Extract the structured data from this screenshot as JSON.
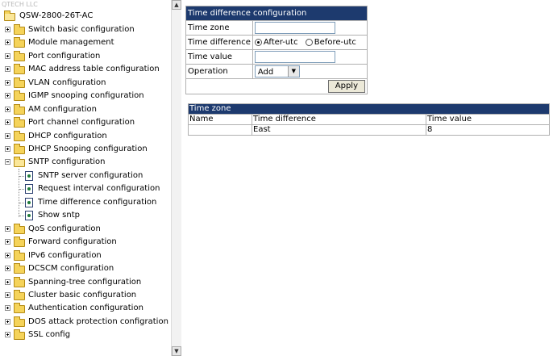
{
  "brand": "QTECH LLC",
  "tree": {
    "root": "QSW-2800-26T-AC",
    "items": [
      {
        "label": "Switch basic configuration"
      },
      {
        "label": "Module management"
      },
      {
        "label": "Port configuration"
      },
      {
        "label": "MAC address table configuration"
      },
      {
        "label": "VLAN configuration"
      },
      {
        "label": "IGMP snooping configuration"
      },
      {
        "label": "AM configuration"
      },
      {
        "label": "Port channel configuration"
      },
      {
        "label": "DHCP configuration"
      },
      {
        "label": "DHCP Snooping configuration"
      },
      {
        "label": "SNTP configuration"
      },
      {
        "label": "QoS configuration"
      },
      {
        "label": "Forward configuration"
      },
      {
        "label": "IPv6 configuration"
      },
      {
        "label": "DCSCM configuration"
      },
      {
        "label": "Spanning-tree configuration"
      },
      {
        "label": "Cluster basic configuration"
      },
      {
        "label": "Authentication configuration"
      },
      {
        "label": "DOS attack protection configration"
      },
      {
        "label": "SSL config"
      }
    ],
    "sntp_children": [
      {
        "label": "SNTP server configuration"
      },
      {
        "label": "Request interval configuration"
      },
      {
        "label": "Time difference configuration"
      },
      {
        "label": "Show sntp"
      }
    ]
  },
  "form": {
    "title": "Time difference configuration",
    "time_zone_label": "Time zone",
    "time_zone_value": "",
    "time_difference_label": "Time difference",
    "after_utc": "After-utc",
    "before_utc": "Before-utc",
    "time_value_label": "Time value",
    "time_value_value": "",
    "operation_label": "Operation",
    "operation_value": "Add",
    "apply": "Apply"
  },
  "zone_table": {
    "title": "Time zone",
    "headers": [
      "Name",
      "Time difference",
      "Time value"
    ],
    "rows": [
      [
        "",
        "East",
        "8"
      ]
    ]
  }
}
